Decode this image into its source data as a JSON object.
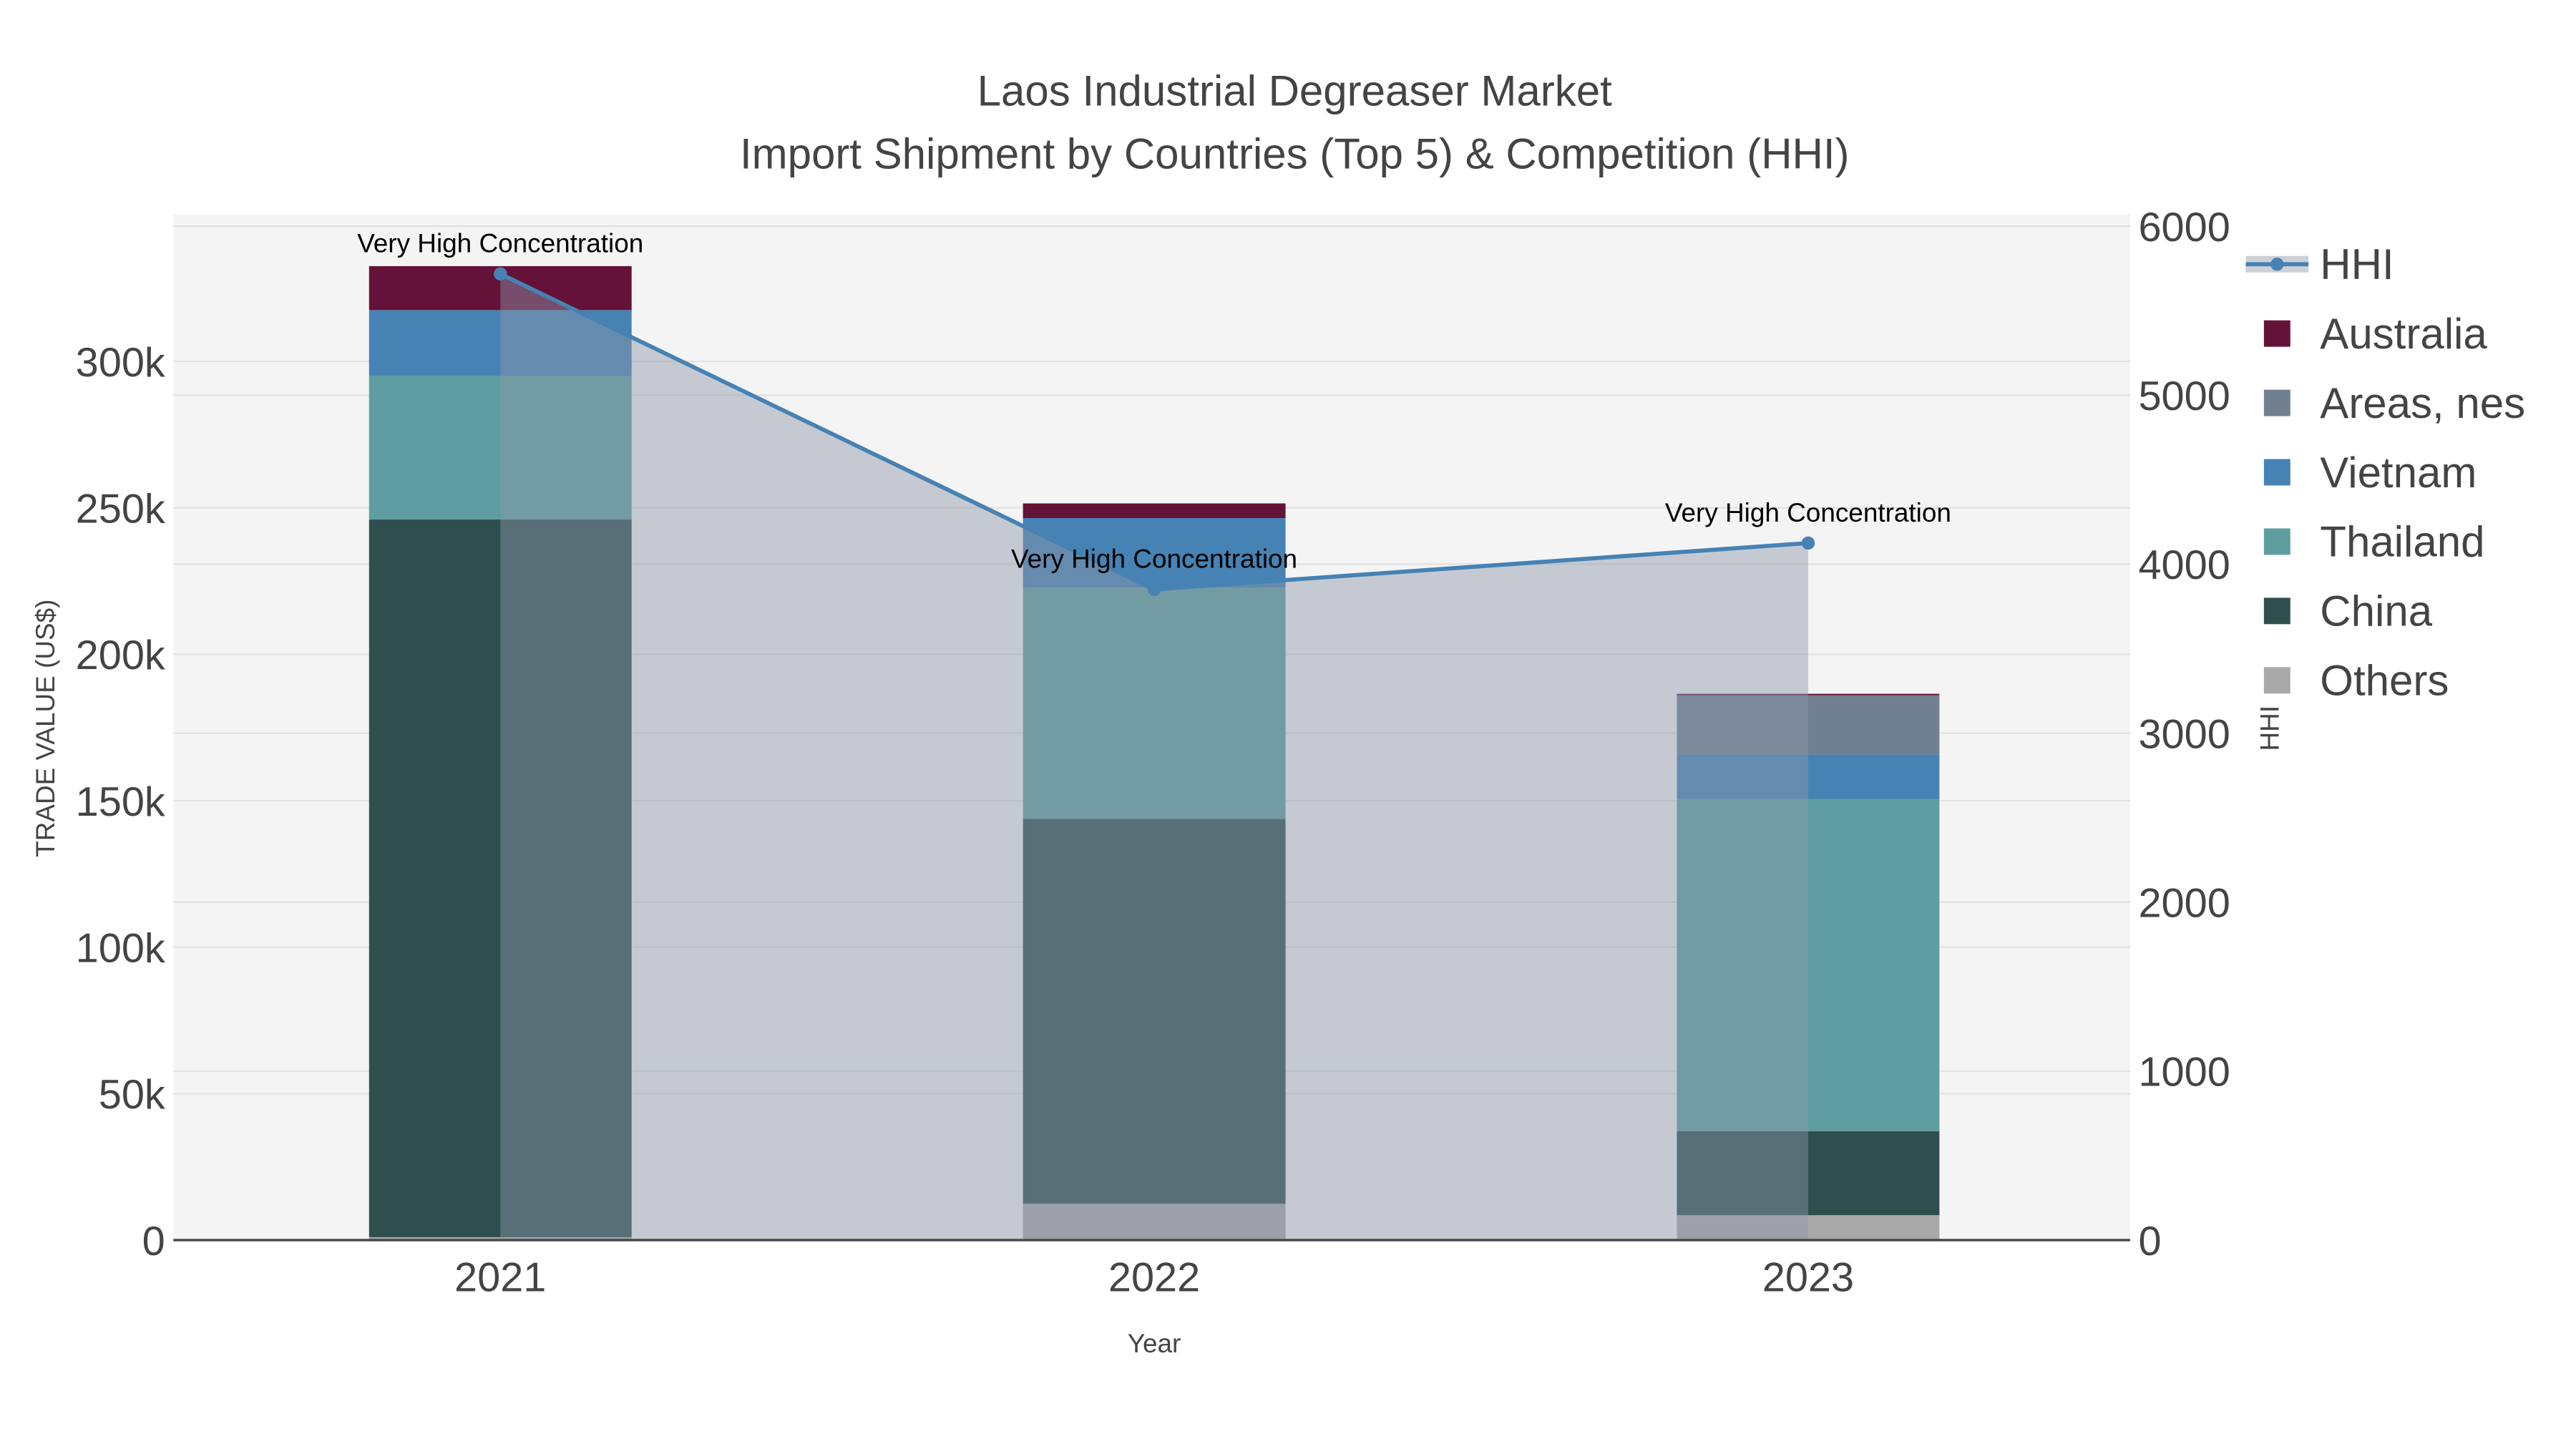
{
  "chart_data": {
    "type": "bar",
    "title": "Laos Industrial Degreaser Market",
    "subtitle": "Import Shipment by Countries (Top 5) & Competition (HHI)",
    "xlabel": "Year",
    "ylabel": "TRADE VALUE (US$)",
    "y2label": "HHI",
    "categories": [
      "2021",
      "2022",
      "2023"
    ],
    "ylim": [
      0,
      345000
    ],
    "y2lim": [
      0,
      6000
    ],
    "yticks": [
      0,
      50000,
      100000,
      150000,
      200000,
      250000,
      300000
    ],
    "ytick_labels": [
      "0",
      "50k",
      "100k",
      "150k",
      "200k",
      "250k",
      "300k"
    ],
    "y2ticks": [
      0,
      1000,
      2000,
      3000,
      4000,
      5000,
      6000
    ],
    "y2tick_labels": [
      "0",
      "1000",
      "2000",
      "3000",
      "4000",
      "5000",
      "6000"
    ],
    "stacked": true,
    "series": [
      {
        "name": "Others",
        "color": "#a9a9a9",
        "values": [
          1000,
          12400,
          8500
        ]
      },
      {
        "name": "China",
        "color": "#2f4f4f",
        "values": [
          245000,
          131400,
          28700
        ]
      },
      {
        "name": "Thailand",
        "color": "#5f9ea0",
        "values": [
          49000,
          79000,
          113400
        ]
      },
      {
        "name": "Vietnam",
        "color": "#4682b4",
        "values": [
          22500,
          23700,
          15200
        ]
      },
      {
        "name": "Areas, nes",
        "color": "#708090",
        "values": [
          0,
          0,
          20200
        ]
      },
      {
        "name": "Australia",
        "color": "#641237",
        "values": [
          15000,
          5000,
          500
        ]
      }
    ],
    "hhi": {
      "name": "HHI",
      "color": "#4682b4",
      "values": [
        5718,
        3851,
        4125
      ]
    },
    "annotations": [
      "Very High Concentration",
      "Very High Concentration",
      "Very High Concentration"
    ],
    "legend_order": [
      "HHI",
      "Australia",
      "Areas, nes",
      "Vietnam",
      "Thailand",
      "China",
      "Others"
    ],
    "legend_position": "right",
    "grid": true
  }
}
